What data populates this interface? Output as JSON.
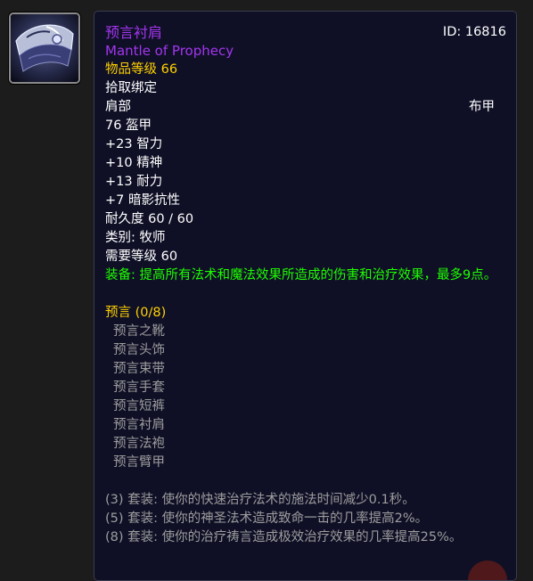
{
  "item": {
    "name_cn": "预言衬肩",
    "name_en": "Mantle of Prophecy",
    "id_label": "ID: 16816",
    "item_level": "物品等级 66",
    "binding": "拾取绑定",
    "slot": "肩部",
    "armor_type": "布甲",
    "armor": "76 盔甲",
    "stats": [
      "+23 智力",
      "+10 精神",
      "+13 耐力",
      "+7 暗影抗性"
    ],
    "durability": "耐久度 60 / 60",
    "class_req": "类别: 牧师",
    "level_req": "需要等级 60",
    "equip_effect": "装备: 提高所有法术和魔法效果所造成的伤害和治疗效果，最多9点。"
  },
  "set": {
    "title": "预言 (0/8)",
    "pieces": [
      "预言之靴",
      "预言头饰",
      "预言束带",
      "预言手套",
      "预言短裤",
      "预言衬肩",
      "预言法袍",
      "预言臂甲"
    ],
    "bonuses": [
      "(3) 套装: 使你的快速治疗法术的施法时间减少0.1秒。",
      "(5) 套装: 使你的神圣法术造成致命一击的几率提高2%。",
      "(8) 套装: 使你的治疗祷言造成极效治疗效果的几率提高25%。"
    ]
  },
  "colors": {
    "epic": "#a335ee",
    "gold": "#ffd100",
    "equip_green": "#1eff00",
    "inactive_gray": "#9d9d9d",
    "tooltip_bg": "#0f1026"
  }
}
